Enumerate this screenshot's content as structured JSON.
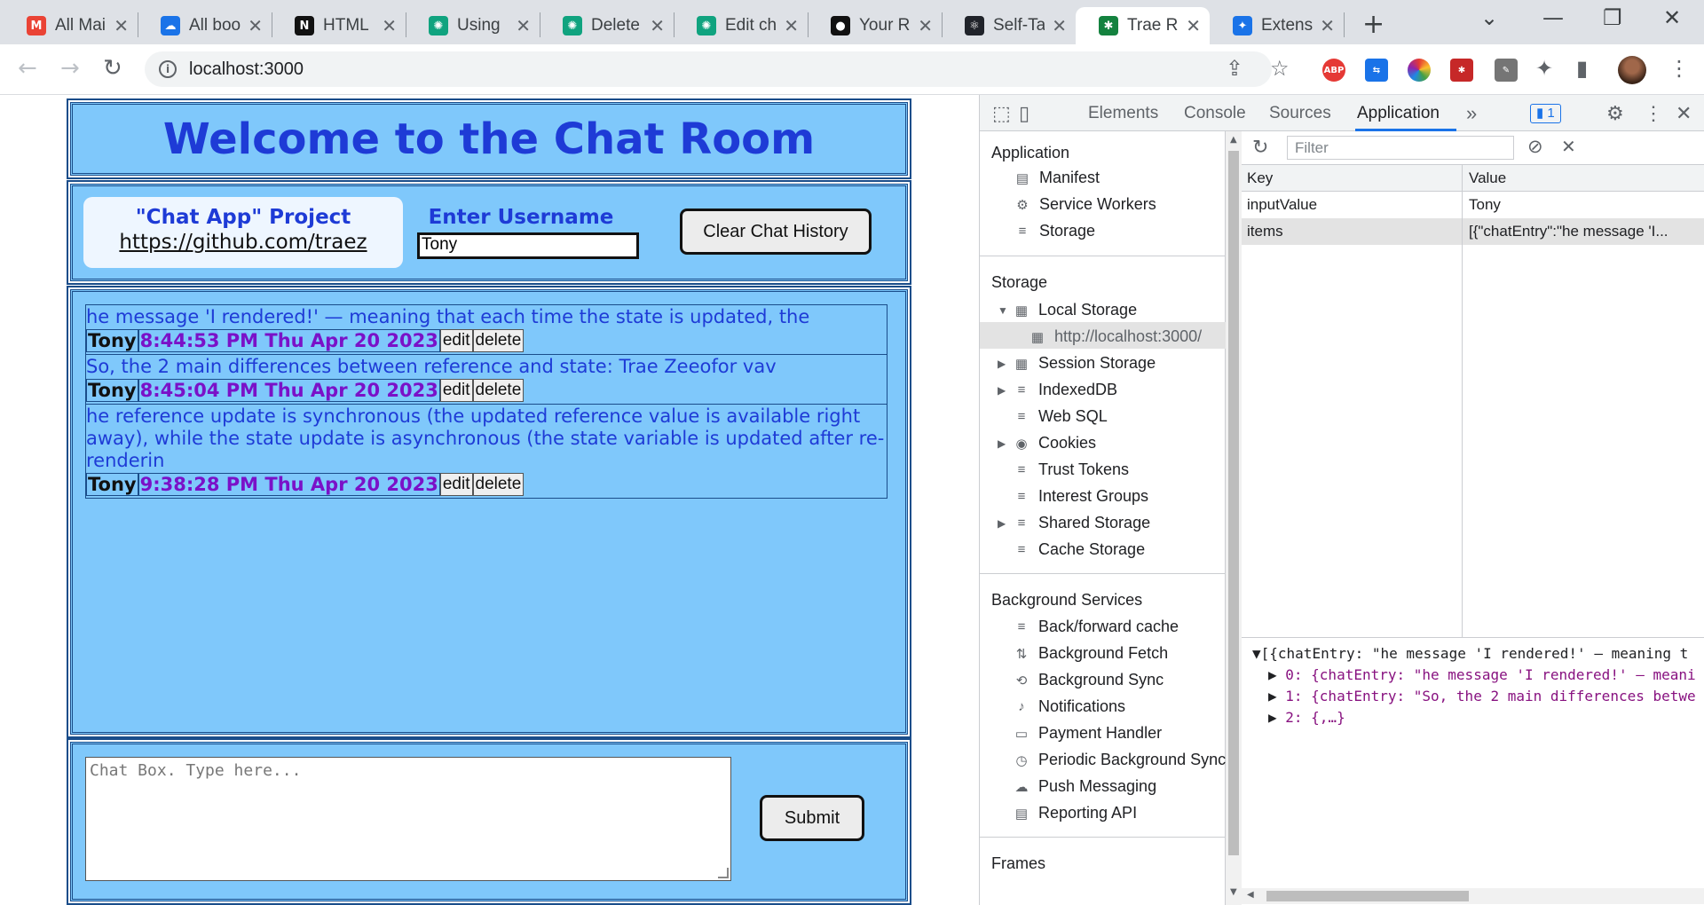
{
  "browser": {
    "tabs": [
      {
        "title": "All Mai",
        "icon": "gmail-icon",
        "color": "#ea4335",
        "glyph": "M"
      },
      {
        "title": "All boo",
        "icon": "cloud-icon",
        "color": "#1a73e8",
        "glyph": "☁"
      },
      {
        "title": "HTML",
        "icon": "notion-icon",
        "color": "#111111",
        "glyph": "N"
      },
      {
        "title": "Using",
        "icon": "chatgpt-icon",
        "color": "#10a37f",
        "glyph": "✺"
      },
      {
        "title": "Delete",
        "icon": "chatgpt-icon",
        "color": "#10a37f",
        "glyph": "✺"
      },
      {
        "title": "Edit ch",
        "icon": "chatgpt-icon",
        "color": "#10a37f",
        "glyph": "✺"
      },
      {
        "title": "Your R",
        "icon": "github-icon",
        "color": "#111111",
        "glyph": "●"
      },
      {
        "title": "Self-Ta",
        "icon": "react-icon",
        "color": "#20232a",
        "glyph": "⚛"
      },
      {
        "title": "Trae R",
        "icon": "app-icon",
        "color": "#14823f",
        "glyph": "✱"
      },
      {
        "title": "Extensi",
        "icon": "puzzle-icon",
        "color": "#1a73e8",
        "glyph": "✦"
      }
    ],
    "url": "localhost:3000"
  },
  "app": {
    "heading": "Welcome to the Chat Room",
    "project_title": "\"Chat App\" Project",
    "project_link": "https://github.com/traez",
    "username_label": "Enter Username",
    "username_value": "Tony",
    "clear_button": "Clear Chat History",
    "messages": [
      {
        "text": "he message 'I rendered!' — meaning that each time the state is updated, the",
        "user": "Tony",
        "time": "8:44:53 PM Thu Apr 20 2023",
        "edit": "edit",
        "delete": "delete"
      },
      {
        "text": "So, the 2 main differences between reference and state: Trae Zeeofor vav",
        "user": "Tony",
        "time": "8:45:04 PM Thu Apr 20 2023",
        "edit": "edit",
        "delete": "delete"
      },
      {
        "text": "he reference update is synchronous (the updated reference value is available right away), while the state update is asynchronous (the state variable is updated after re-renderin",
        "user": "Tony",
        "time": "9:38:28 PM Thu Apr 20 2023",
        "edit": "edit",
        "delete": "delete"
      }
    ],
    "chat_placeholder": "Chat Box. Type here...",
    "submit_button": "Submit"
  },
  "devtools": {
    "tabs": [
      "Elements",
      "Console",
      "Sources",
      "Application"
    ],
    "active_tab": "Application",
    "badge": "1",
    "sidebar": {
      "application_title": "Application",
      "application_items": [
        "Manifest",
        "Service Workers",
        "Storage"
      ],
      "storage_title": "Storage",
      "storage_items": [
        "Local Storage",
        "http://localhost:3000/",
        "Session Storage",
        "IndexedDB",
        "Web SQL",
        "Cookies",
        "Trust Tokens",
        "Interest Groups",
        "Shared Storage",
        "Cache Storage"
      ],
      "background_title": "Background Services",
      "background_items": [
        "Back/forward cache",
        "Background Fetch",
        "Background Sync",
        "Notifications",
        "Payment Handler",
        "Periodic Background Sync",
        "Push Messaging",
        "Reporting API"
      ],
      "frames_title": "Frames"
    },
    "filter_placeholder": "Filter",
    "table": {
      "headers": [
        "Key",
        "Value"
      ],
      "rows": [
        {
          "key": "inputValue",
          "value": "Tony"
        },
        {
          "key": "items",
          "value": "[{\"chatEntry\":\"he message 'I..."
        }
      ]
    },
    "preview": [
      "[{chatEntry: \"he message 'I rendered!' — meaning t",
      "0: {chatEntry: \"he message 'I rendered!' — meani",
      "1: {chatEntry: \"So, the 2 main differences betwe",
      "2: {,…}"
    ]
  }
}
